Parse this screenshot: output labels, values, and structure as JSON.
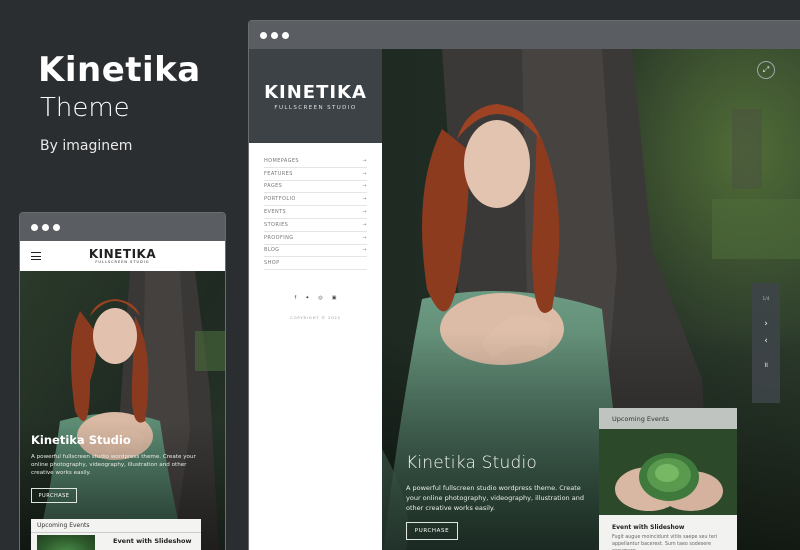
{
  "promo": {
    "title": "Kinetika",
    "subtitle": "Theme",
    "author": "By imaginem"
  },
  "mobile": {
    "logo_title": "KINETIKA",
    "logo_subtitle": "FULLSCREEN STUDIO",
    "studio_title": "Kinetika Studio",
    "description": "A powerful fullscreen studio wordpress theme. Create your online photography, videography, illustration and other creative works easily.",
    "purchase_label": "PURCHASE",
    "events_title": "Upcoming Events",
    "event_label": "Event with Slideshow"
  },
  "desktop": {
    "logo_title": "KINETIKA",
    "logo_subtitle": "FULLSCREEN STUDIO",
    "menu": [
      {
        "label": "HOMEPAGES",
        "arrow": "→"
      },
      {
        "label": "FEATURES",
        "arrow": "→"
      },
      {
        "label": "PAGES",
        "arrow": "→"
      },
      {
        "label": "PORTFOLIO",
        "arrow": "→"
      },
      {
        "label": "EVENTS",
        "arrow": "→"
      },
      {
        "label": "STORIES",
        "arrow": "→"
      },
      {
        "label": "PROOFING",
        "arrow": "→"
      },
      {
        "label": "BLOG",
        "arrow": "→"
      },
      {
        "label": "SHOP",
        "arrow": ""
      }
    ],
    "social": [
      "f",
      "✦",
      "◎",
      "▣"
    ],
    "copyright": "COPYRIGHT © 2022",
    "slide_counter": "1/4",
    "next_icon": "›",
    "prev_icon": "‹",
    "pause_icon": "॥",
    "expand_icon": "⤢",
    "studio_title": "Kinetika Studio",
    "description": "A powerful fullscreen studio wordpress theme. Create your online photography, videography, illustration and other creative works easily.",
    "purchase_label": "PURCHASE",
    "events_title": "Upcoming Events",
    "event_title": "Event with Slideshow",
    "event_desc": "Fugit augue moincidunt vitiis saepe seu teri appellantur bacerest. Sum taeo sodesere eccumare"
  }
}
